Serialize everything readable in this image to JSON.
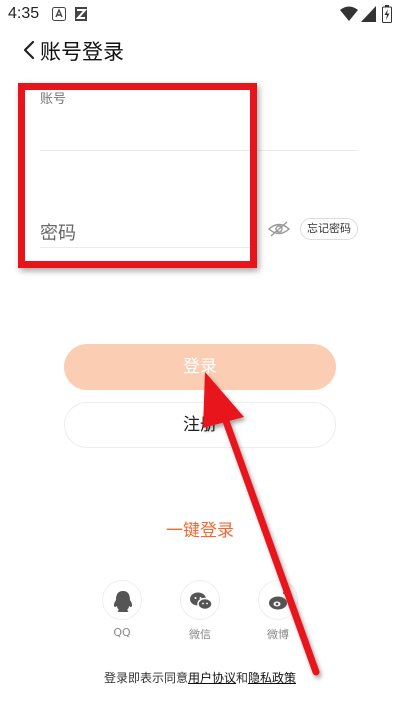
{
  "status_bar": {
    "time": "4:35"
  },
  "header": {
    "title": "账号登录"
  },
  "form": {
    "account_label": "账号",
    "account_value": "",
    "password_placeholder": "密码",
    "forgot_label": "忘记密码"
  },
  "buttons": {
    "login": "登录",
    "register": "注册"
  },
  "one_key_login": "一键登录",
  "social": [
    {
      "label": "QQ",
      "icon": "qq-icon"
    },
    {
      "label": "微信",
      "icon": "wechat-icon"
    },
    {
      "label": "微博",
      "icon": "weibo-icon"
    }
  ],
  "agreement": {
    "prefix": "登录即表示同意",
    "user_agreement": "用户协议",
    "and": "和",
    "privacy_policy": "隐私政策"
  },
  "colors": {
    "accent": "#f06a33",
    "login_button": "#fbcdb3",
    "annotation_red": "#e8141c"
  }
}
